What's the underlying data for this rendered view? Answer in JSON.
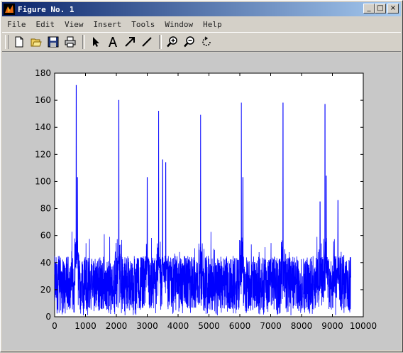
{
  "window": {
    "title": "Figure No. 1",
    "controls": [
      "_",
      "□",
      "×"
    ]
  },
  "menu": [
    "File",
    "Edit",
    "View",
    "Insert",
    "Tools",
    "Window",
    "Help"
  ],
  "toolbar": {
    "buttons": [
      "new-figure-icon",
      "open-file-icon",
      "save-icon",
      "print-icon",
      "select-arrow-icon",
      "insert-text-icon",
      "insert-arrow-icon",
      "insert-line-icon",
      "zoom-in-icon",
      "zoom-out-icon",
      "rotate-3d-icon"
    ]
  },
  "colors": {
    "series": "#0000ff",
    "background": "#c8c8c8",
    "titlebar_start": "#0a246a",
    "titlebar_end": "#a6caf0"
  },
  "chart_data": {
    "type": "line",
    "title": "",
    "xlabel": "",
    "ylabel": "",
    "xlim": [
      0,
      10000
    ],
    "ylim": [
      0,
      180
    ],
    "xticks": [
      "0",
      "1000",
      "2000",
      "3000",
      "4000",
      "5000",
      "6000",
      "7000",
      "8000",
      "9000",
      "10000"
    ],
    "yticks": [
      "0",
      "20",
      "40",
      "60",
      "80",
      "100",
      "120",
      "140",
      "160",
      "180"
    ],
    "grid": false,
    "series": [
      {
        "color": "#0000ff",
        "x_range": [
          0,
          9600
        ],
        "baseline_band": [
          5,
          45
        ],
        "peaks": [
          {
            "x": 700,
            "y": 171
          },
          {
            "x": 740,
            "y": 103
          },
          {
            "x": 2080,
            "y": 160
          },
          {
            "x": 3370,
            "y": 152
          },
          {
            "x": 3500,
            "y": 116
          },
          {
            "x": 3600,
            "y": 114
          },
          {
            "x": 3000,
            "y": 103
          },
          {
            "x": 4730,
            "y": 149
          },
          {
            "x": 6050,
            "y": 158
          },
          {
            "x": 6100,
            "y": 103
          },
          {
            "x": 7400,
            "y": 158
          },
          {
            "x": 8760,
            "y": 157
          },
          {
            "x": 8800,
            "y": 104
          },
          {
            "x": 8600,
            "y": 85
          },
          {
            "x": 9180,
            "y": 86
          }
        ]
      }
    ]
  }
}
